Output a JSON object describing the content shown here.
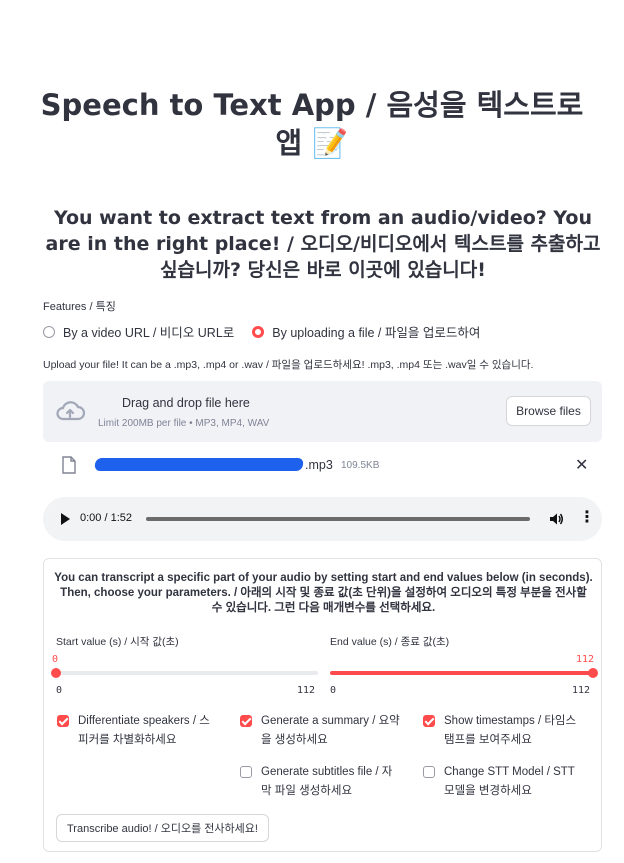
{
  "app": {
    "title": "Speech to Text App / 음성을 텍스트로 앱 📝",
    "subtitle": "You want to extract text from an audio/video? You are in the right place! / 오디오/비디오에서 텍스트를 추출하고 싶습니까? 당신은 바로 이곳에 있습니다!"
  },
  "features": {
    "label": "Features / 특징",
    "options": [
      {
        "label": "By a video URL / 비디오 URL로",
        "selected": false
      },
      {
        "label": "By uploading a file / 파일을 업로드하여",
        "selected": true
      }
    ]
  },
  "uploader": {
    "label": "Upload your file! It can be a .mp3, .mp4 or .wav / 파일을 업로드하세요! .mp3, .mp4 또는 .wav일 수 있습니다.",
    "drag_text": "Drag and drop file here",
    "limit_text": "Limit 200MB per file • MP3, MP4, WAV",
    "browse_label": "Browse files",
    "icon": "cloud-upload-icon",
    "file": {
      "extension": ".mp3",
      "size": "109.5KB",
      "close": "✕"
    }
  },
  "player": {
    "time": "0:00 / 1:52",
    "progress": 0,
    "more": "⋮"
  },
  "options_panel": {
    "description": "You can transcript a specific part of your audio by setting start and end values below (in seconds). Then, choose your parameters. / 아래의 시작 및 종료 값(초 단위)을 설정하여 오디오의 특정 부분을 전사할 수 있습니다. 그런 다음 매개변수를 선택하세요.",
    "start_slider": {
      "label": "Start value (s) / 시작 값(초)",
      "value": "0",
      "min": "0",
      "max": "112"
    },
    "end_slider": {
      "label": "End value (s) / 종료 값(초)",
      "value": "112",
      "min": "0",
      "max": "112"
    },
    "checkboxes": [
      {
        "label": "Differentiate speakers / 스피커를 차별화하세요",
        "checked": true
      },
      {
        "label": "Generate a summary / 요약을 생성하세요",
        "checked": true
      },
      {
        "label": "Show timestamps / 타임스탬프를 보여주세요",
        "checked": true
      },
      {
        "label": "Generate subtitles file / 자막 파일 생성하세요",
        "checked": false
      },
      {
        "label": "Change STT Model / STT 모델을 변경하세요",
        "checked": false
      }
    ],
    "transcribe_label": "Transcribe audio! / 오디오를 전사하세요!"
  },
  "colors": {
    "accent": "#ff4b4b",
    "redaction": "#1d61ec",
    "dropzone_bg": "#f0f2f6",
    "text": "#31333f"
  }
}
